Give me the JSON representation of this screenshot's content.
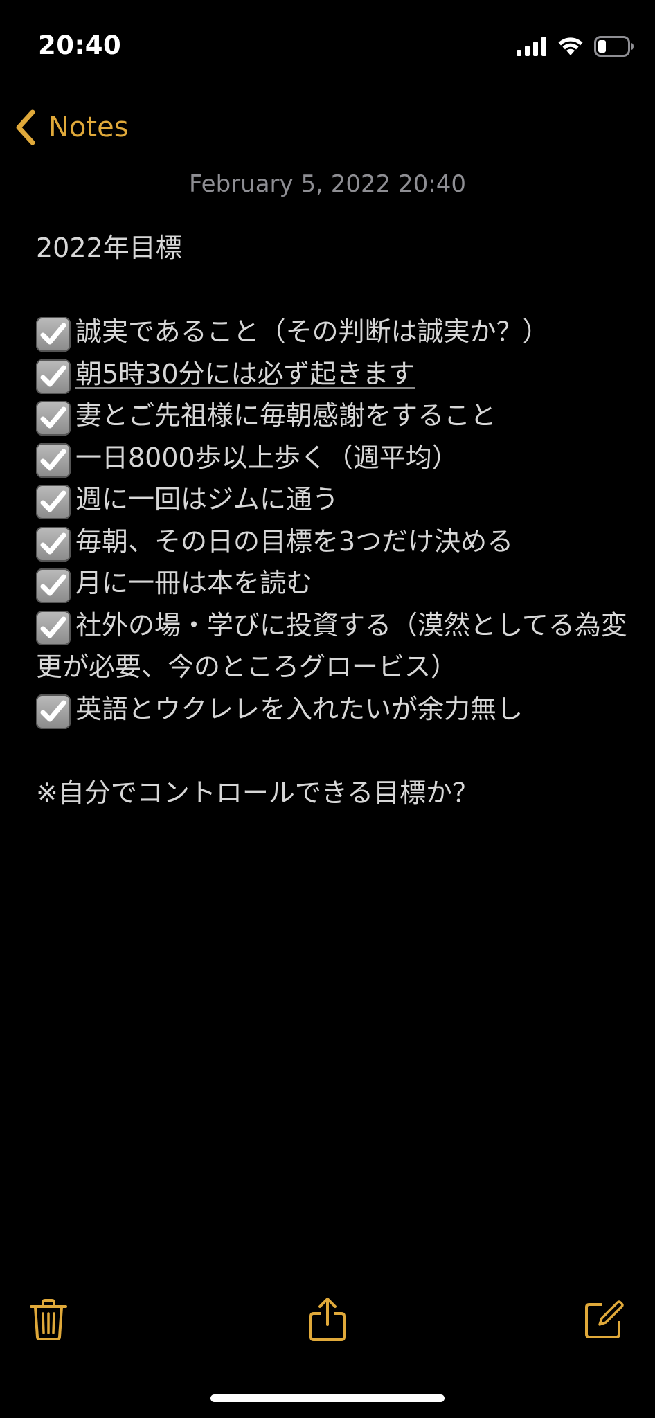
{
  "status_bar": {
    "time": "20:40"
  },
  "nav": {
    "back_label": "Notes"
  },
  "note": {
    "date": "February 5, 2022 20:40",
    "title": "2022年目標",
    "items": [
      {
        "text": "誠実であること（その判断は誠実か？）",
        "checked": true
      },
      {
        "text": "朝5時30分には必ず起きます",
        "checked": true
      },
      {
        "text": "妻とご先祖様に毎朝感謝をすること",
        "checked": true
      },
      {
        "text": "一日8000歩以上歩く（週平均）",
        "checked": true
      },
      {
        "text": "週に一回はジムに通う",
        "checked": true
      },
      {
        "text": "毎朝、その日の目標を3つだけ決める",
        "checked": true
      },
      {
        "text": "月に一冊は本を読む",
        "checked": true
      },
      {
        "text": "社外の場・学びに投資する（漠然としてる為変更が必要、今のところグロービス）",
        "checked": true
      },
      {
        "text": "英語とウクレレを入れたいが余力無し",
        "checked": true
      }
    ],
    "footnote": "※自分でコントロールできる目標か？"
  },
  "toolbar": {
    "icons": [
      "trash-icon",
      "share-icon",
      "compose-icon"
    ]
  },
  "colors": {
    "accent": "#e0a93a",
    "background": "#000000",
    "text": "#d7d7d7",
    "date_text": "#8e8e93"
  }
}
